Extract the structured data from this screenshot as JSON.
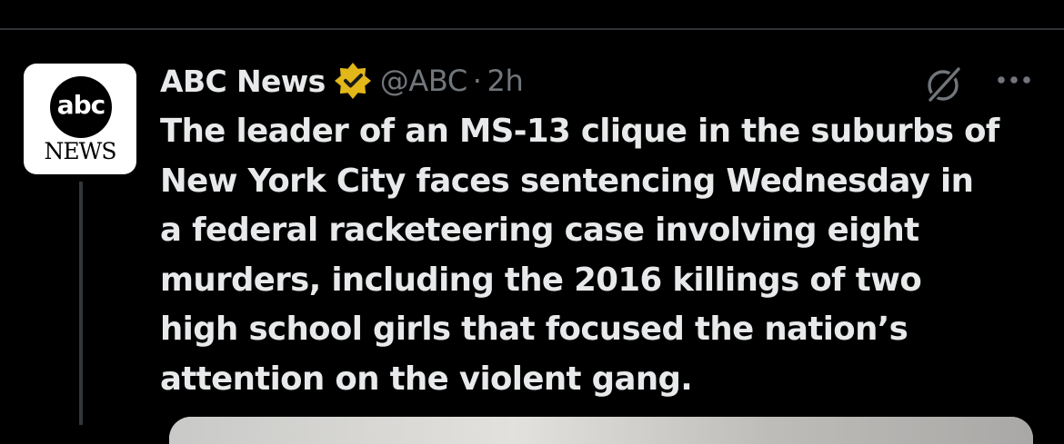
{
  "author": {
    "name": "ABC News",
    "handle": "@ABC",
    "separator": "·",
    "timestamp": "2h",
    "verified_badge": "gold-verified-badge",
    "badge_color": "#e2b719"
  },
  "avatar": {
    "logo_mark": "abc",
    "logo_sub": "NEWS"
  },
  "icons": {
    "grok": "grok-slash-circle-icon",
    "more": "more-options-icon"
  },
  "tweet": {
    "lines": [
      "The leader of an MS-13 clique in the suburbs of",
      "New York City faces sentencing Wednesday in",
      "a federal racketeering case involving eight",
      "murders, including the 2016 killings of two",
      "high school girls that focused the nation’s",
      "attention on the violent gang."
    ]
  },
  "colors": {
    "background": "#000000",
    "primary_text": "#e7e9ea",
    "secondary_text": "#71767b",
    "divider": "#2f3336"
  }
}
